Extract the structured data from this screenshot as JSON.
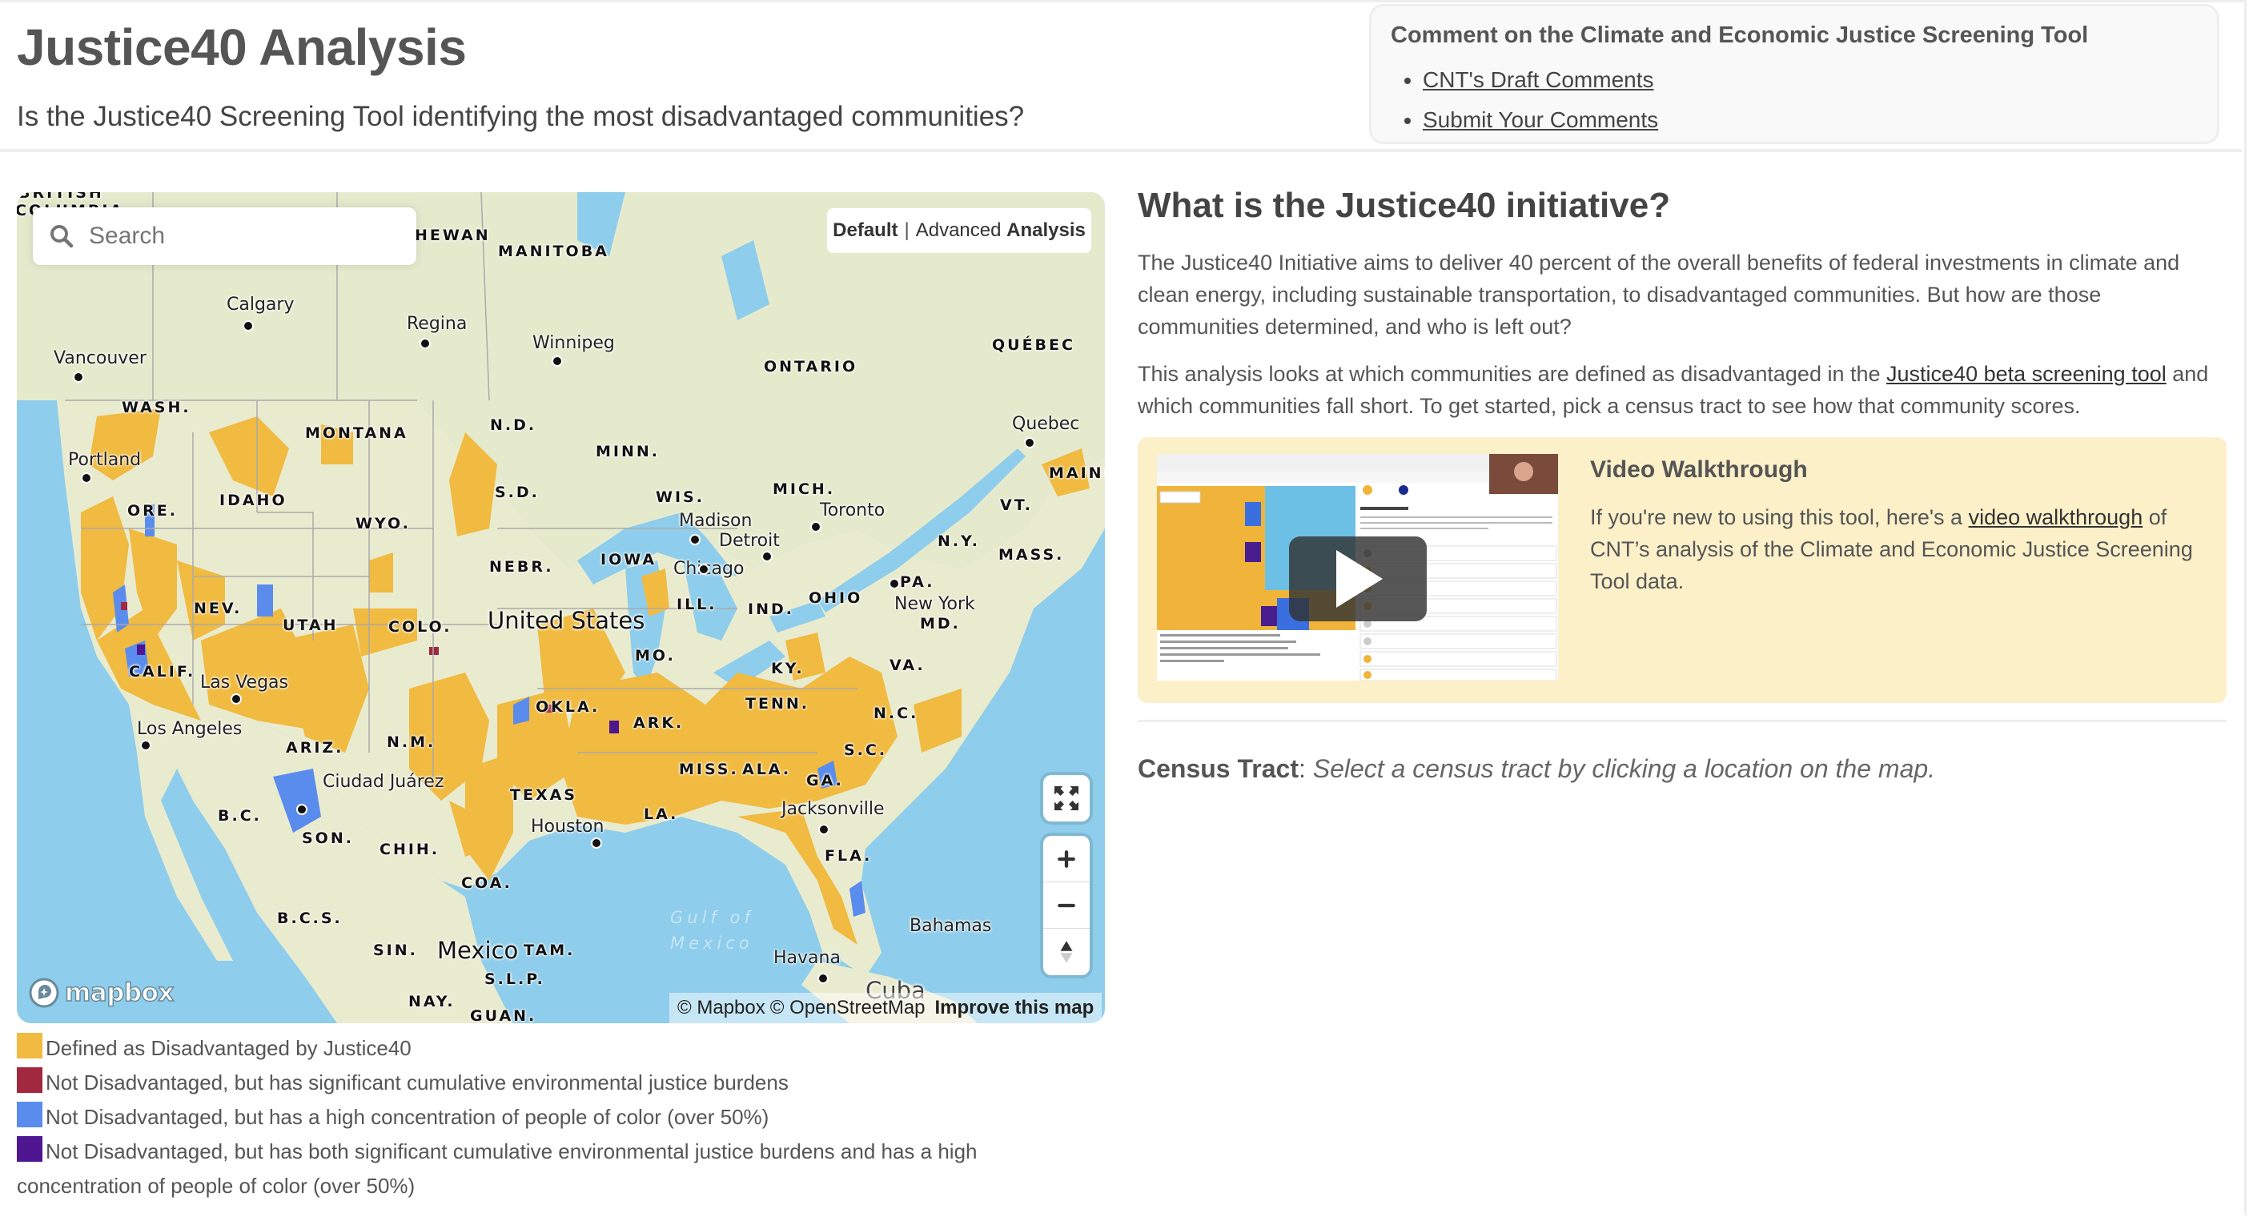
{
  "header": {
    "title": "Justice40 Analysis",
    "subtitle": "Is the Justice40 Screening Tool identifying the most disadvantaged communities?"
  },
  "comment_card": {
    "heading": "Comment on the Climate and Economic Justice Screening Tool",
    "links": [
      {
        "label": "CNT's Draft Comments"
      },
      {
        "label": "Submit Your Comments"
      }
    ]
  },
  "map": {
    "search": {
      "placeholder": "Search",
      "value": ""
    },
    "mode_toggle": {
      "default_label": "Default",
      "separator": "|",
      "advanced_label_1": "Advanced",
      "advanced_label_2": "Analysis",
      "selected": "Default"
    },
    "controls": {
      "fullscreen": "fullscreen-icon",
      "zoom_in": "plus-icon",
      "zoom_out": "minus-icon",
      "compass": "compass-icon"
    },
    "logo": "mapbox",
    "attribution": {
      "mapbox": "© Mapbox",
      "osm": "© OpenStreetMap",
      "improve": "Improve this map"
    },
    "labels": {
      "regions": [
        "BRITISH",
        "COLUMBIA",
        "HEWAN",
        "MANITOBA",
        "ONTARIO",
        "QUÉBEC",
        "WASH.",
        "MONTANA",
        "N.D.",
        "MINN.",
        "ORE.",
        "IDAHO",
        "S.D.",
        "WIS.",
        "MICH.",
        "WYO.",
        "IOWA",
        "NEBR.",
        "NEV.",
        "UTAH",
        "COLO.",
        "ILL.",
        "IND.",
        "OHIO",
        "PA.",
        "N.Y.",
        "VT.",
        "MAINE",
        "MASS.",
        "MD.",
        "CALIF.",
        "MO.",
        "KY.",
        "VA.",
        "ARIZ.",
        "N.M.",
        "OKLA.",
        "TENN.",
        "N.C.",
        "ARK.",
        "S.C.",
        "MISS.",
        "ALA.",
        "GA.",
        "TEXAS",
        "LA.",
        "FLA.",
        "B.C.",
        "SON.",
        "CHIH.",
        "COA.",
        "B.C.S.",
        "SIN.",
        "TAM.",
        "NAY.",
        "S.L.P.",
        "GUAN."
      ],
      "cities": [
        "Calgary",
        "Regina",
        "Winnipeg",
        "Vancouver",
        "Portland",
        "Quebec",
        "Toronto",
        "Madison",
        "Detroit",
        "Chicago",
        "New York",
        "Las Vegas",
        "Los Angeles",
        "Ciudad Juárez",
        "Houston",
        "Jacksonville",
        "Havana",
        "Bahamas",
        "Cuba"
      ],
      "countries": [
        "United States",
        "Mexico"
      ],
      "water": [
        "Gulf of",
        "Mexico"
      ]
    },
    "colors": {
      "disadvantaged": "#F1BA40",
      "burdens": "#A1283F",
      "people_of_color": "#5A8CEE",
      "both": "#4E1690",
      "water": "#8ECDEB",
      "land": "#E8EBCF"
    }
  },
  "legend": [
    {
      "color": "#F1BA40",
      "label": "Defined as Disadvantaged by Justice40"
    },
    {
      "color": "#A1283F",
      "label": "Not Disadvantaged, but has significant cumulative environmental justice burdens"
    },
    {
      "color": "#5A8CEE",
      "label": "Not Disadvantaged, but has a high concentration of people of color (over 50%)"
    },
    {
      "color": "#4E1690",
      "label": "Not Disadvantaged, but has both significant cumulative environmental justice burdens and has a high concentration of people of color (over 50%)"
    }
  ],
  "info": {
    "heading": "What is the Justice40 initiative?",
    "paragraph1": "The Justice40 Initiative aims to deliver 40 percent of the overall benefits of federal investments in climate and clean energy, including sustainable transportation, to disadvantaged communities. But how are those communities determined, and who is left out?",
    "paragraph2_before": "This analysis looks at which communities are defined as disadvantaged in the ",
    "paragraph2_link": "Justice40 beta screening tool",
    "paragraph2_after": " and which communities fall short. To get started, pick a census tract to see how that community scores."
  },
  "video": {
    "title": "Video Walkthrough",
    "text_before": "If you're new to using this tool, here's a ",
    "link": "video walkthrough",
    "text_after": " of CNT’s analysis of the Climate and Economic Justice Screening Tool data.",
    "play_icon": "play-icon",
    "thumbnail_headings": [
      "Cumulative Impacts"
    ],
    "thumbnail_rows": [
      "Climate change",
      "Clean energy and energy efficiency",
      "Clean transit",
      "Affordable and sustainable housing",
      "Reduction and remediation of legacy pollution",
      "Critical clean water and waste infrastructure",
      "Health burdens",
      "Training and workforce development"
    ]
  },
  "census_tract": {
    "label": "Census Tract",
    "prompt": "Select a census tract by clicking a location on the map."
  }
}
